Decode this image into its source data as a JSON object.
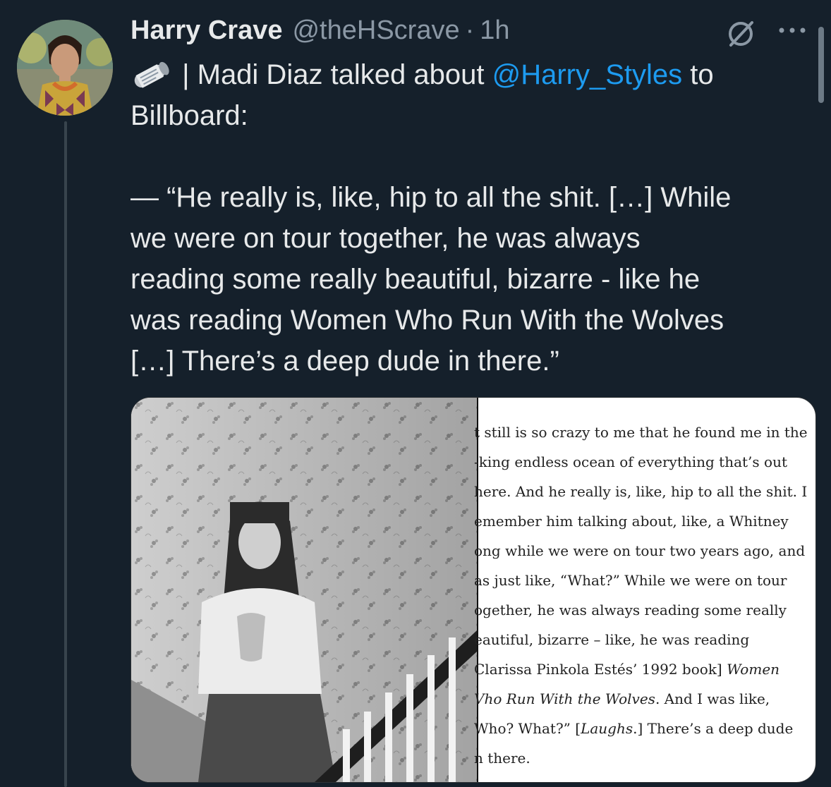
{
  "tweet": {
    "author": {
      "display_name": "Harry Crave",
      "handle": "@theHScrave",
      "separator": "·",
      "time": "1h"
    },
    "icons": {
      "badge": "grok-icon",
      "menu": "more-icon",
      "emoji": "rolled-newspaper-icon"
    },
    "text": {
      "line1_rest": " | Madi Diaz talked about ",
      "mention": "@Harry_Styles",
      "line1_tail": " to",
      "line2": "Billboard:",
      "quote_lines": [
        "— “He really is, like, hip to all the shit. […] While",
        "we were on tour together, he was always",
        "reading some really beautiful, bizarre - like he",
        "was reading Women Who Run With the Wolves",
        "[…] There’s a deep dude in there.”"
      ]
    },
    "media": {
      "article_lines": [
        "t still is so crazy to me that he found me in the",
        "-king endless ocean of everything that’s out",
        "here. And he really is, like, hip to all the shit. I",
        "emember him talking about, like, a Whitney",
        "ong while we were on tour two years ago, and",
        "as just like, “What?” While we were on tour",
        "ogether, he was always reading some really",
        "eautiful, bizarre – like, he was reading",
        "Clarissa Pinkola Estés’ 1992 book] ",
        "Vho Run With the Wolves",
        ". And I was like,",
        "Who? What?” [",
        "Laughs",
        ".] There’s a deep dude",
        "n there."
      ],
      "article_italic_1": "Women"
    }
  },
  "colors": {
    "background": "#15202b",
    "text": "#e7e9ea",
    "secondary": "#8b98a5",
    "link": "#1d9bf0"
  }
}
